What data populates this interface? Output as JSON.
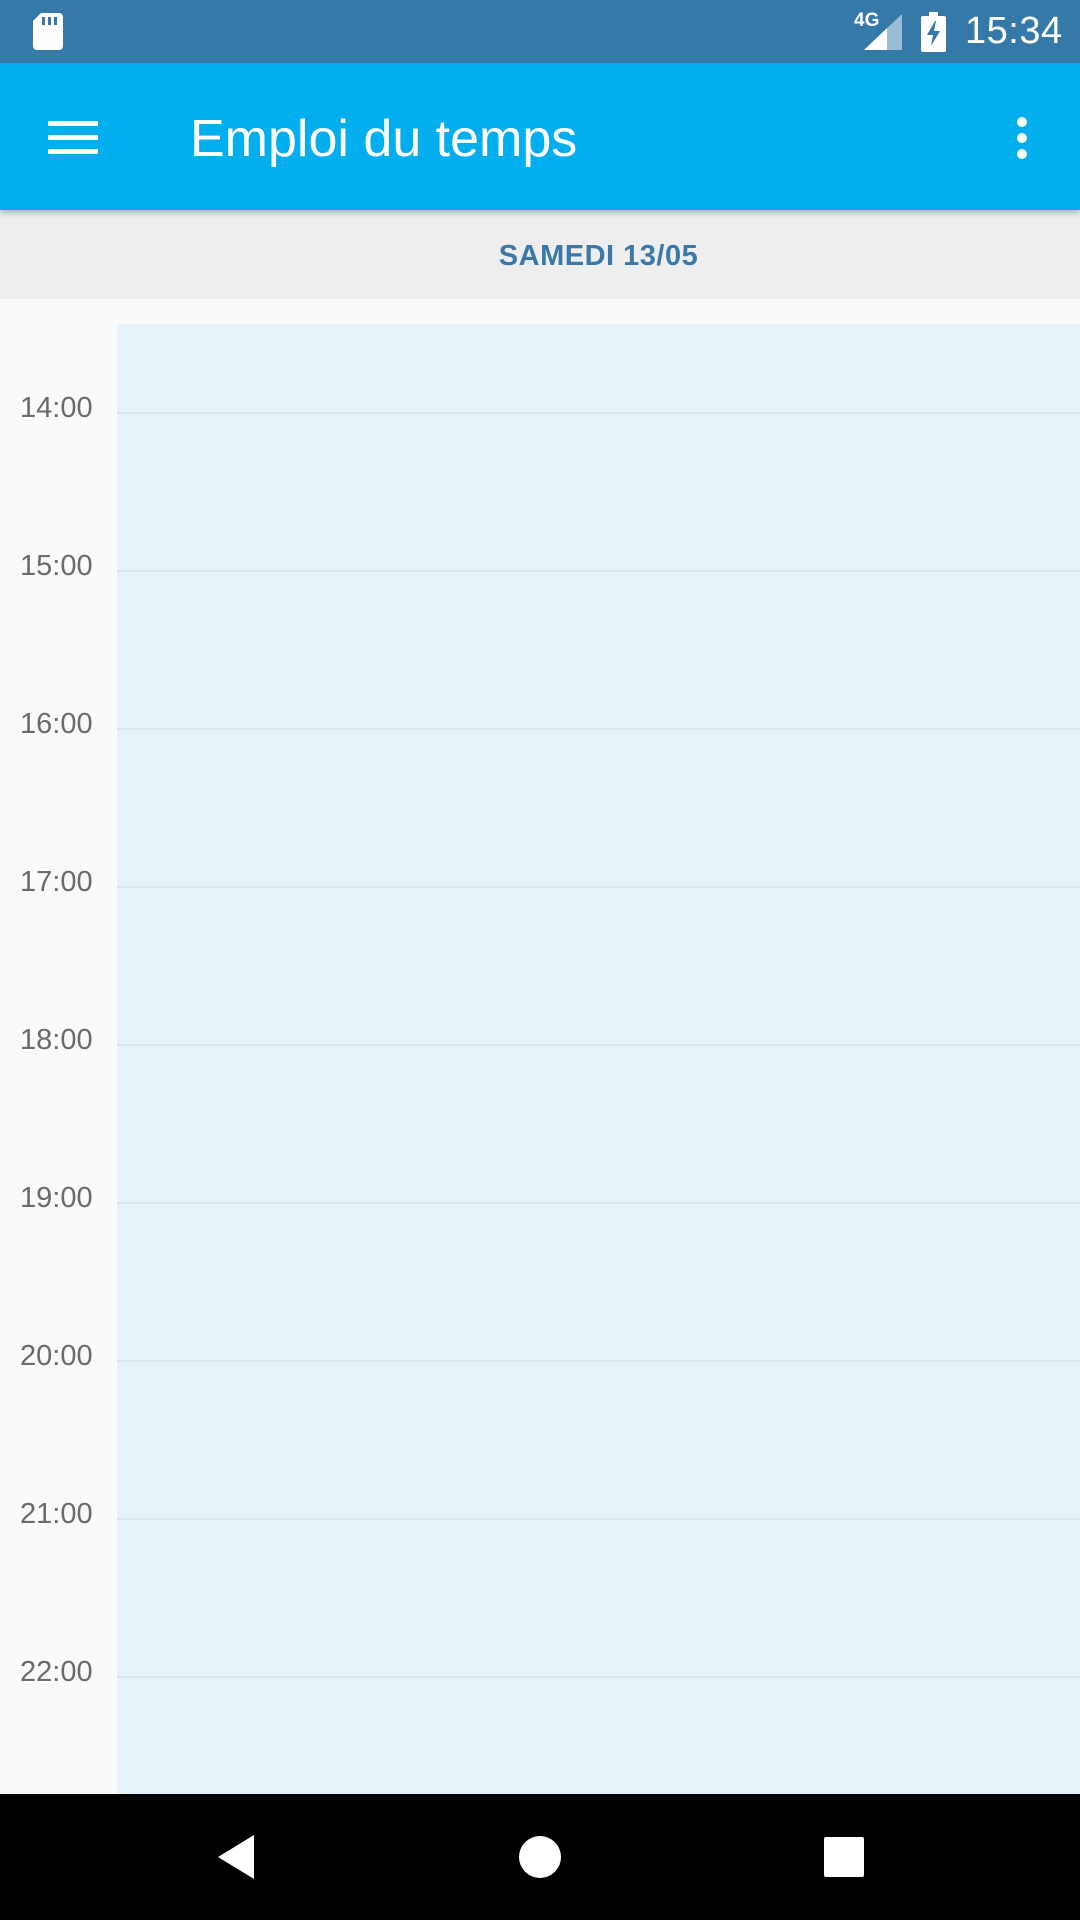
{
  "status_bar": {
    "time": "15:34",
    "network": "4G",
    "icons": [
      "sd-card-icon",
      "signal-icon",
      "battery-charging-icon"
    ]
  },
  "app_bar": {
    "title": "Emploi du temps",
    "icons": [
      "menu-icon",
      "more-vert-icon"
    ]
  },
  "day_header": {
    "label": "SAMEDI 13/05"
  },
  "timeline": {
    "hours": [
      "14:00",
      "15:00",
      "16:00",
      "17:00",
      "18:00",
      "19:00",
      "20:00",
      "21:00",
      "22:00"
    ]
  },
  "nav_bar": {
    "icons": [
      "back-icon",
      "home-icon",
      "recents-icon"
    ]
  },
  "colors": {
    "status_bar": "#3579a8",
    "app_bar": "#03aeef",
    "day_label": "#3a78a8",
    "day_column": "#e8f2f9",
    "day_header_bg": "#eeeeee"
  }
}
